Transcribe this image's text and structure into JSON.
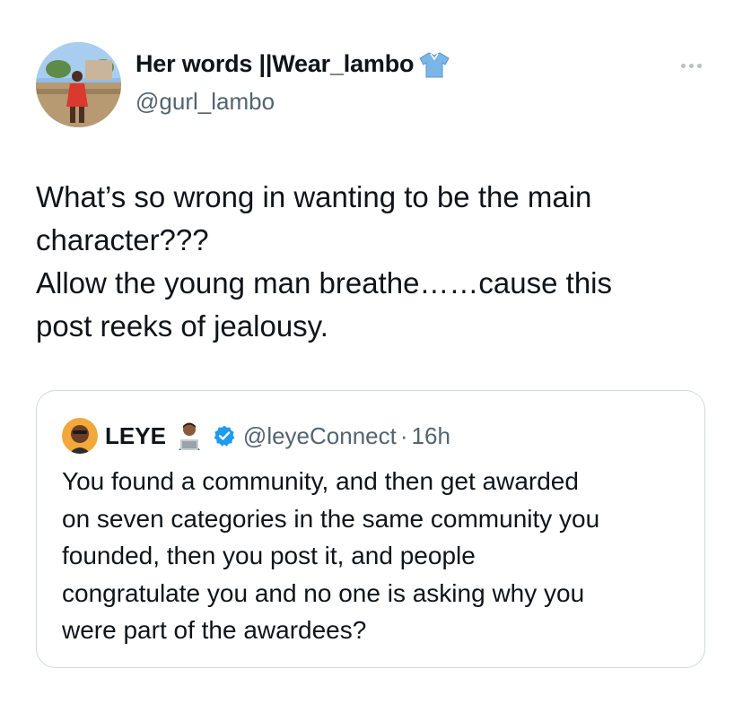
{
  "author": {
    "display_name": "Her words ||Wear_lambo",
    "handle": "@gurl_lambo",
    "name_emoji": "shirt-icon"
  },
  "tweet": {
    "lines": [
      "What’s so wrong in wanting to be the main",
      "character???",
      "Allow the young man breathe……cause this",
      "post reeks of jealousy."
    ]
  },
  "quoted_tweet": {
    "display_name": "LEYE",
    "name_emoji": "technologist-icon",
    "verified": true,
    "handle": "@leyeConnect",
    "separator": "·",
    "time": "16h",
    "lines": [
      "You found a community, and then get awarded",
      "on seven categories in the same community you",
      "founded, then you post it, and people",
      "congratulate you and no one is asking why you",
      "were part of the awardees?"
    ]
  },
  "colors": {
    "text_primary": "#0f1419",
    "text_secondary": "#536471",
    "border": "#cfd9de",
    "verified_blue": "#1d9bf0"
  }
}
